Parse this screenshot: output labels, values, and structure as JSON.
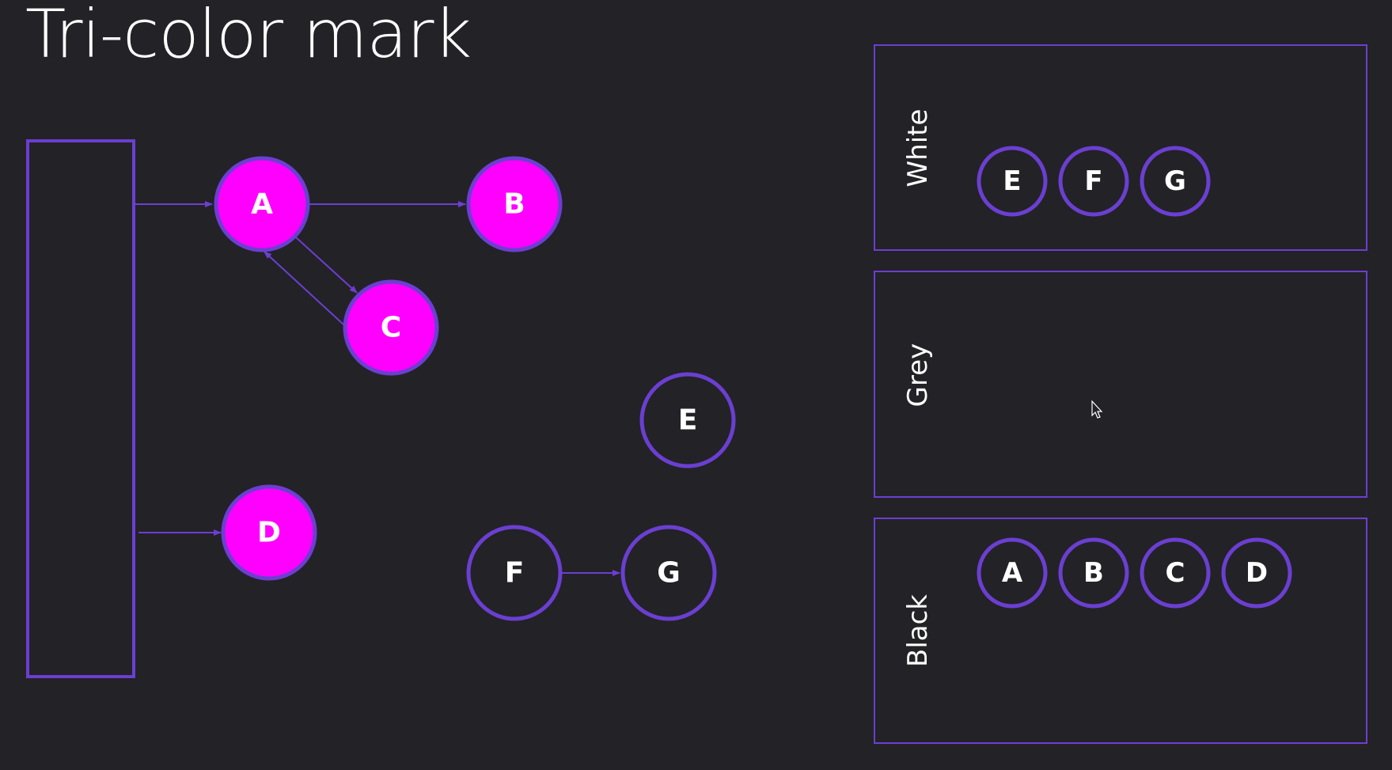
{
  "title": "Tri-color mark",
  "colors": {
    "background": "#232227",
    "outline": "#6b3fd1",
    "marked_fill": "#ff00ff",
    "text": "#ffffff"
  },
  "graph": {
    "nodes": [
      {
        "id": "A",
        "label": "A",
        "marked": true
      },
      {
        "id": "B",
        "label": "B",
        "marked": true
      },
      {
        "id": "C",
        "label": "C",
        "marked": true
      },
      {
        "id": "D",
        "label": "D",
        "marked": true
      },
      {
        "id": "E",
        "label": "E",
        "marked": false
      },
      {
        "id": "F",
        "label": "F",
        "marked": false
      },
      {
        "id": "G",
        "label": "G",
        "marked": false
      }
    ],
    "edges": [
      {
        "from": "roots",
        "to": "A"
      },
      {
        "from": "roots",
        "to": "D"
      },
      {
        "from": "A",
        "to": "B"
      },
      {
        "from": "A",
        "to": "C"
      },
      {
        "from": "C",
        "to": "A"
      },
      {
        "from": "F",
        "to": "G"
      }
    ]
  },
  "sets": {
    "white": {
      "label": "White",
      "items": [
        "E",
        "F",
        "G"
      ]
    },
    "grey": {
      "label": "Grey",
      "items": []
    },
    "black": {
      "label": "Black",
      "items": [
        "A",
        "B",
        "C",
        "D"
      ]
    }
  }
}
